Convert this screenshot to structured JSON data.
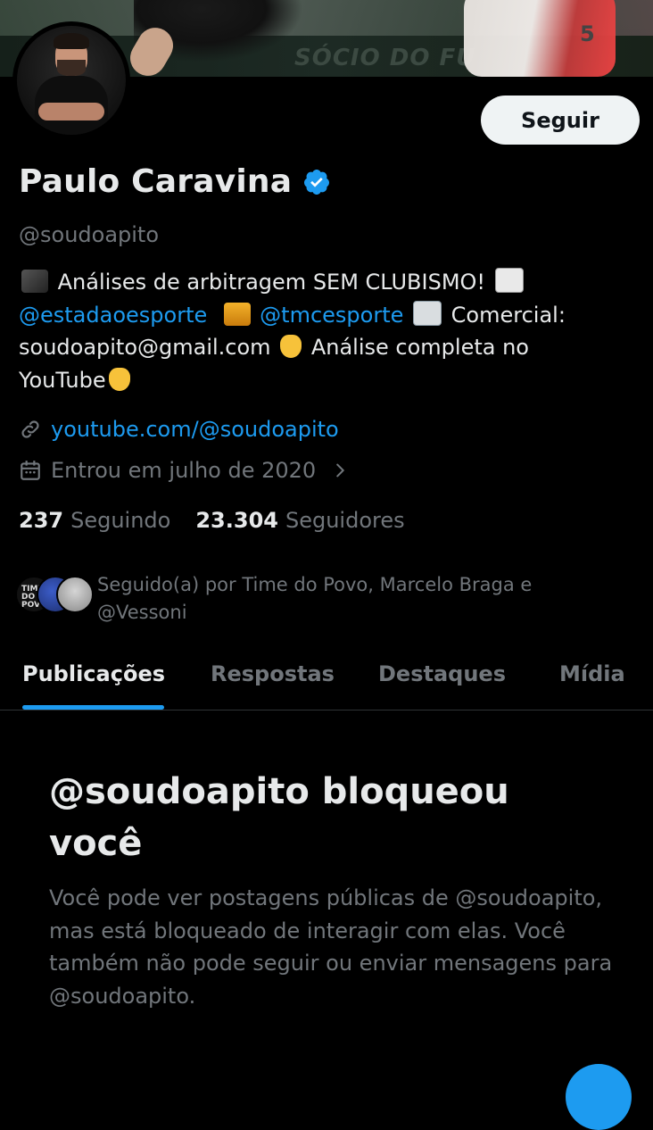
{
  "profile": {
    "name": "Paulo Caravina",
    "handle": "@soudoapito",
    "follow_label": "Seguir",
    "bio": {
      "line1_text": "Análises de arbitragem SEM CLUBISMO!",
      "mention1": "@estadaoesporte",
      "mention2": "@tmcesporte",
      "commercial": "Comercial:",
      "email": "soudoapito@gmail.com",
      "after_email": "Análise completa no",
      "youtube": "YouTube"
    },
    "website": "youtube.com/@soudoapito",
    "joined": "Entrou em julho de 2020",
    "following_count": "237",
    "following_label": "Seguindo",
    "followers_count": "23.304",
    "followers_label": "Seguidores",
    "followed_by_line1": "Seguido(a) por Time do Povo, Marcelo Braga e",
    "followed_by_line2": "@Vessoni",
    "mini_avatar_text": "TIME DO POVO"
  },
  "tabs": [
    {
      "label": "Publicações"
    },
    {
      "label": "Respostas"
    },
    {
      "label": "Destaques"
    },
    {
      "label": "Mídia"
    }
  ],
  "blocked": {
    "title": "@soudoapito bloqueou você",
    "description": "Você pode ver postagens públicas de @soudoapito, mas está bloqueado de interagir com elas. Você também não pode seguir ou enviar mensagens para @soudoapito."
  },
  "banner": {
    "board_text": "SÓCIO DO FU",
    "jersey_number": "5"
  },
  "colors": {
    "accent": "#1d9bf0",
    "background": "#000000",
    "text_primary": "#e7e9ea",
    "text_secondary": "#71767b"
  },
  "icons": {
    "verified": "verified-badge-icon",
    "link": "link-icon",
    "calendar": "calendar-icon",
    "chevron": "chevron-right-icon"
  }
}
